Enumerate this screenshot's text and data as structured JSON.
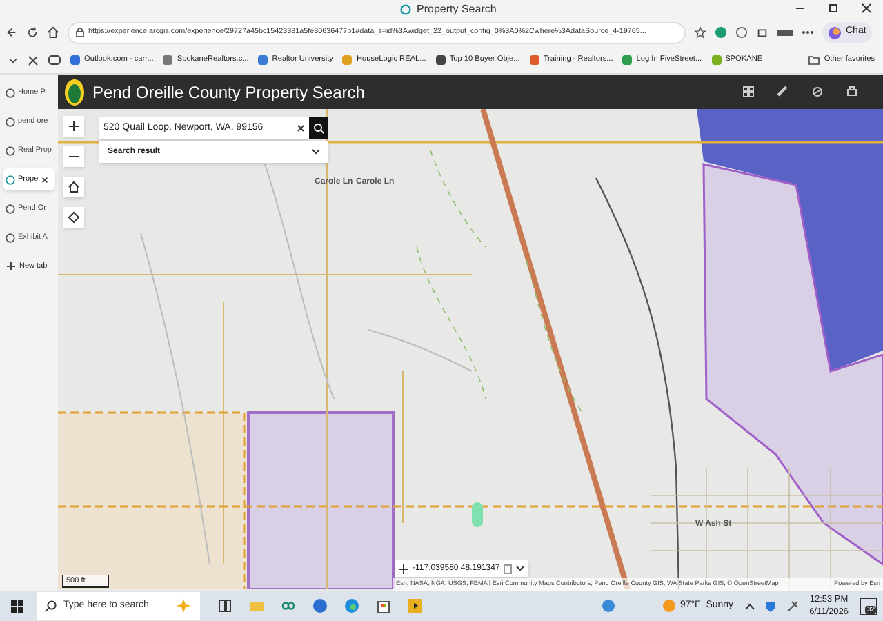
{
  "window": {
    "title": "Property Search"
  },
  "address_bar": {
    "url": "https://experience.arcgis.com/experience/29727a45bc15423381a5fe30636477b1#data_s=id%3Awidget_22_output_config_0%3A0%2Cwhere%3AdataSource_4-19765..."
  },
  "toolbar": {
    "chat_label": "Chat"
  },
  "favorites": [
    {
      "label": "Outlook.com - carr..."
    },
    {
      "label": "SpokaneRealtors.c..."
    },
    {
      "label": "Realtor University"
    },
    {
      "label": "HouseLogic  REAL..."
    },
    {
      "label": "Top 10 Buyer Obje..."
    },
    {
      "label": "Training - Realtors..."
    },
    {
      "label": "Log In  FiveStreet..."
    },
    {
      "label": "SPOKANE"
    }
  ],
  "other_favorites": "Other favorites",
  "vertical_tabs": [
    {
      "label": "Home P",
      "selected": false
    },
    {
      "label": "pend ore",
      "selected": false
    },
    {
      "label": "Real Prop",
      "selected": false
    },
    {
      "label": "Prope",
      "selected": true
    },
    {
      "label": "Pend Or",
      "selected": false
    },
    {
      "label": "Exhibit A",
      "selected": false
    }
  ],
  "new_tab": "New tab",
  "app": {
    "title": "Pend Oreille County Property Search"
  },
  "search": {
    "value": "520 Quail Loop, Newport, WA, 99156",
    "result_label": "Search result"
  },
  "map": {
    "labels": [
      {
        "text": "Carole Ln"
      },
      {
        "text": "Carole Ln"
      },
      {
        "text": "W Ash St"
      }
    ],
    "scale": "500 ft",
    "coordinates": "-117.039580 48.191347",
    "attribution": "Esri, NASA, NGA, USGS, FEMA | Esri Community Maps Contributors, Pend Oreille County GIS, WA State Parks GIS, © OpenStreetMap",
    "powered_by": "Powered by Esri"
  },
  "taskbar": {
    "search_placeholder": "Type here to search",
    "weather": "97°F  Sunny",
    "time": "12:53 PM",
    "date": "6/11/2026",
    "notification_count": "32"
  }
}
